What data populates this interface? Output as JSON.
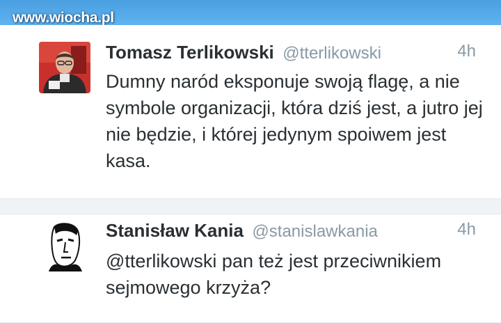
{
  "watermark": "www.wiocha.pl",
  "colors": {
    "topbar": "#55acee",
    "name": "#292f33",
    "meta": "#8899a6",
    "background": "#f5f8fa"
  },
  "tweets": [
    {
      "display_name": "Tomasz Terlikowski",
      "handle": "@tterlikowski",
      "time": "4h",
      "text": "Dumny naród eksponuje swoją flagę, a nie symbole organizacji, która dziś jest, a jutro jej nie będzie, i której jedynym spoiwem jest kasa.",
      "avatar_icon": "avatar-photo"
    },
    {
      "display_name": "Stanisław Kania",
      "handle": "@stanislawkania",
      "time": "4h",
      "text": "@tterlikowski pan też jest przeciwnikiem sejmowego krzyża?",
      "avatar_icon": "avatar-sketch"
    }
  ]
}
